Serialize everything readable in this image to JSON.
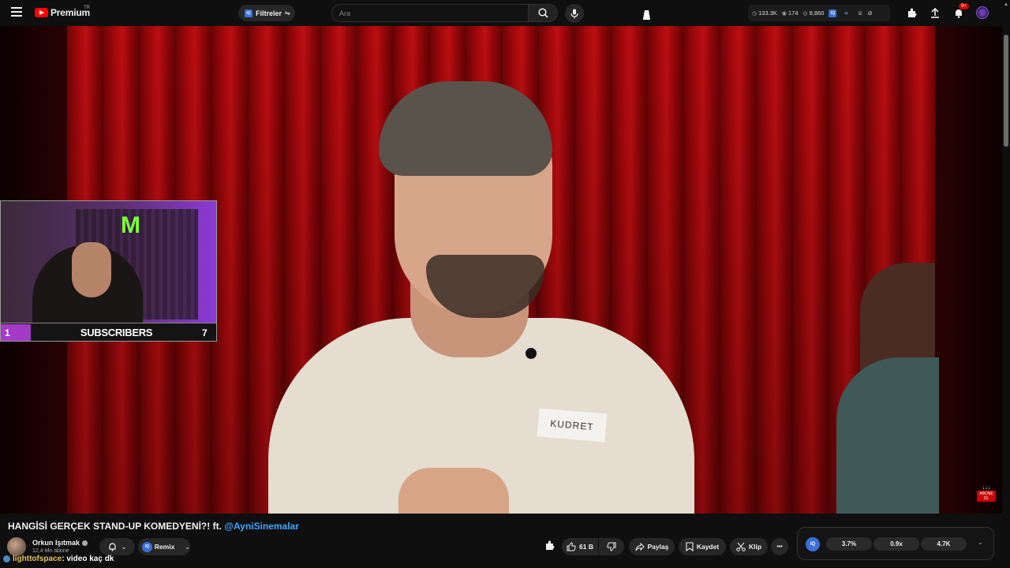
{
  "header": {
    "logo_text": "Premium",
    "region": "TR",
    "filter_label": "Filtreler",
    "filter_badge": "IQ",
    "search_placeholder": "Ara",
    "stats": {
      "views": "133.3K",
      "likes": "174",
      "comments": "8,860"
    },
    "notification_count": "9+"
  },
  "player": {
    "nametag": "KUDRET",
    "overlay": {
      "left_count": "1",
      "label": "SUBSCRIBERS",
      "right_count": "7",
      "watermark": "ABONE OL"
    }
  },
  "video": {
    "title_prefix": "HANGİSİ GERÇEK STAND-UP KOMEDYENİ?! ft.",
    "title_mention": "@AyniSinemalar"
  },
  "channel": {
    "name": "Orkun Işıtmak",
    "subscribers": "12,4 Mn abone"
  },
  "actions": {
    "remix_label": "Remix",
    "remix_badge": "IQ",
    "likes_label": "61 B",
    "share_label": "Paylaş",
    "save_label": "Kaydet",
    "clip_label": "Klip",
    "more_label": "•••"
  },
  "stats_panel": {
    "badge": "IQ",
    "stat1": "3.7%",
    "stat2": "0.9x",
    "stat3": "4.7K"
  },
  "chat": {
    "user": "lighttofspace",
    "message": ": video kaç dk"
  },
  "colors": {
    "accent": "#3ea6ff",
    "brand": "#ff0000",
    "overlay_purple": "#a33bc8"
  }
}
